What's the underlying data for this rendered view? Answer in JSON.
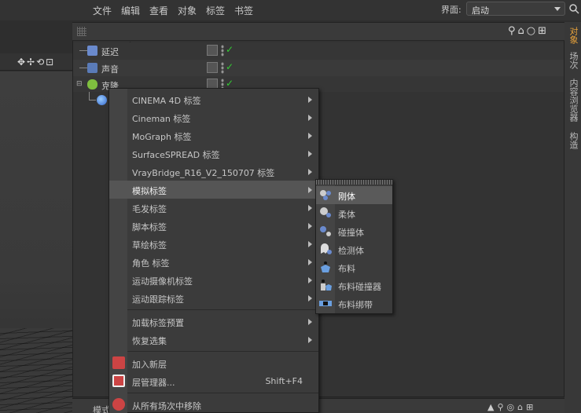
{
  "topbar": {
    "layout_label": "界面:",
    "layout_value": "启动"
  },
  "om": {
    "menu": [
      "文件",
      "编辑",
      "查看",
      "对象",
      "标签",
      "书签"
    ],
    "objects": [
      {
        "name": "延迟"
      },
      {
        "name": "声音"
      },
      {
        "name": "克隆"
      },
      {
        "name": ""
      }
    ]
  },
  "right_tabs": [
    "对象",
    "场次",
    "内容浏览器",
    "构造"
  ],
  "bottom": {
    "label": "模式"
  },
  "context_menu": {
    "items": [
      {
        "label": "CINEMA 4D 标签",
        "submenu": true
      },
      {
        "label": "Cineman 标签",
        "submenu": true
      },
      {
        "label": "MoGraph 标签",
        "submenu": true
      },
      {
        "label": "SurfaceSPREAD 标签",
        "submenu": true
      },
      {
        "label": "VrayBridge_R16_V2_150707 标签",
        "submenu": true
      },
      {
        "label": "模拟标签",
        "submenu": true
      },
      {
        "label": "毛发标签",
        "submenu": true
      },
      {
        "label": "脚本标签",
        "submenu": true
      },
      {
        "label": "草绘标签",
        "submenu": true
      },
      {
        "label": "角色 标签",
        "submenu": true
      },
      {
        "label": "运动摄像机标签",
        "submenu": true
      },
      {
        "label": "运动跟踪标签",
        "submenu": true
      }
    ],
    "items2": [
      {
        "label": "加载标签预置",
        "submenu": true
      },
      {
        "label": "恢复选集",
        "submenu": true
      }
    ],
    "items3": [
      {
        "label": "加入新层",
        "shortcut": ""
      },
      {
        "label": "层管理器...",
        "shortcut": "Shift+F4"
      }
    ],
    "items4": [
      {
        "label": "从所有场次中移除"
      }
    ]
  },
  "submenu": {
    "items": [
      "刚体",
      "柔体",
      "碰撞体",
      "检测体",
      "布料",
      "布料碰撞器",
      "布料绑带"
    ]
  },
  "colors": {
    "accent": "#e8a23a",
    "check": "#33cc33",
    "highlight": "#555555"
  }
}
